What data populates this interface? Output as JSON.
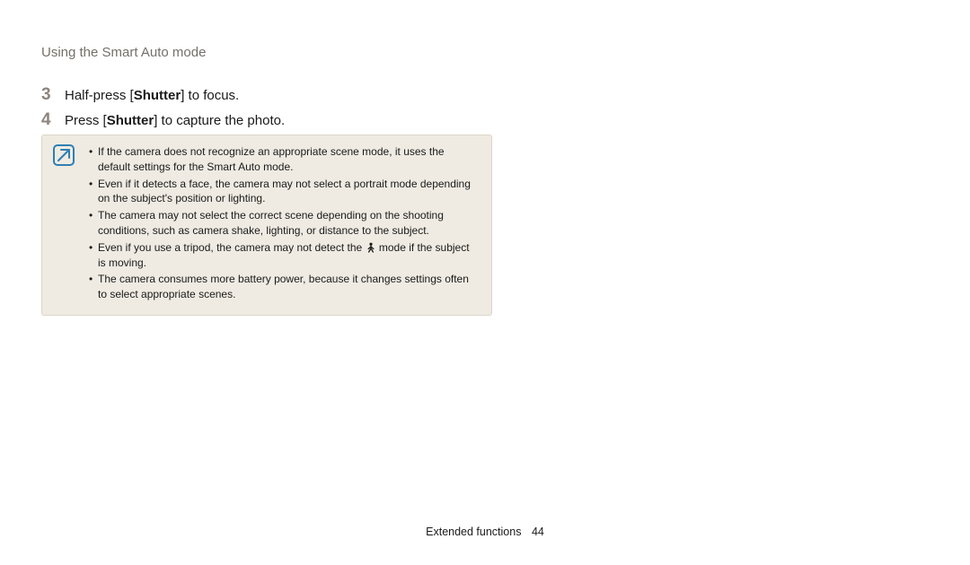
{
  "section_title": "Using the Smart Auto mode",
  "steps": [
    {
      "num": "3",
      "pre": "Half-press [",
      "bold": "Shutter",
      "post": "] to focus."
    },
    {
      "num": "4",
      "pre": "Press [",
      "bold": "Shutter",
      "post": "] to capture the photo."
    }
  ],
  "note_icon_name": "note-info-icon",
  "notes": {
    "n1": "If the camera does not recognize an appropriate scene mode, it uses the default settings for the Smart Auto mode.",
    "n2": "Even if it detects a face, the camera may not select a portrait mode depending on the subject's position or lighting.",
    "n3": "The camera may not select the correct scene depending on the shooting conditions, such as camera shake, lighting, or distance to the subject.",
    "n4_pre": "Even if you use a tripod, the camera may not detect the ",
    "n4_post": " mode if the subject is moving.",
    "n5": "The camera consumes more battery power, because it changes settings often to select appropriate scenes."
  },
  "footer": {
    "label": "Extended functions",
    "page": "44"
  }
}
